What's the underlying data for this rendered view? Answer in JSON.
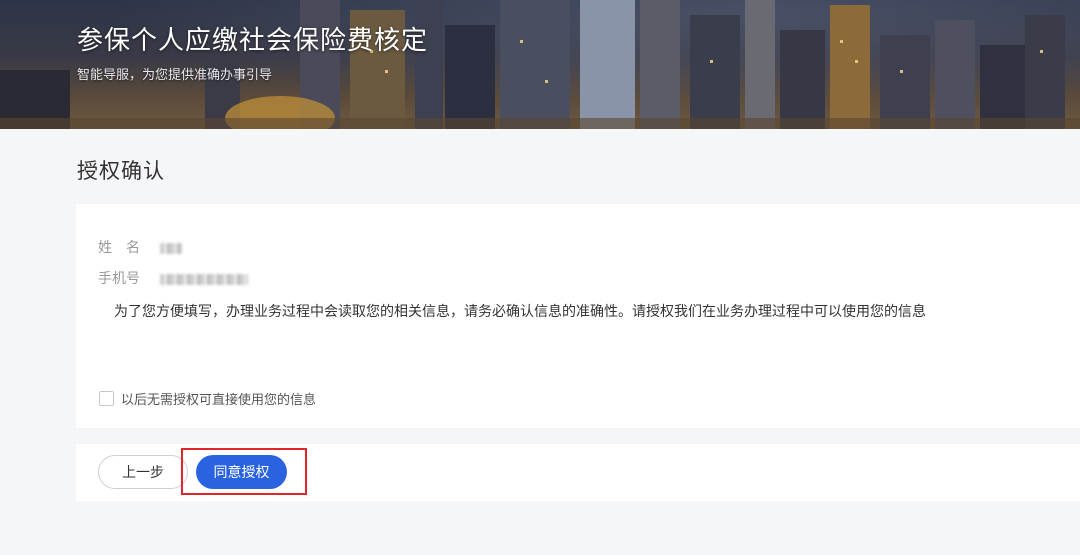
{
  "banner": {
    "title": "参保个人应缴社会保险费核定",
    "subtitle": "智能导服，为您提供准确办事引导"
  },
  "page": {
    "title": "授权确认"
  },
  "form": {
    "name_label": "姓　名",
    "phone_label": "手机号",
    "notice": "为了您方便填写，办理业务过程中会读取您的相关信息，请务必确认信息的准确性。请授权我们在业务办理过程中可以使用您的信息",
    "checkbox_label": "以后无需授权可直接使用您的信息",
    "checkbox_checked": false
  },
  "actions": {
    "prev_label": "上一步",
    "agree_label": "同意授权"
  },
  "colors": {
    "primary": "#2a63e0",
    "highlight": "#e0262b"
  }
}
